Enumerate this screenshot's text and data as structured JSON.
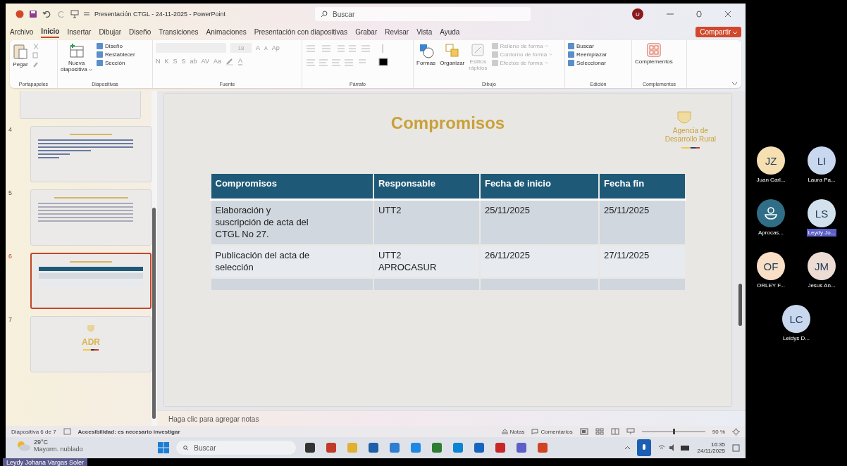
{
  "window": {
    "title": "Presentación CTGL - 24-11-2025 - PowerPoint",
    "search_placeholder": "Buscar",
    "avatar": "U"
  },
  "menu": {
    "tabs": [
      {
        "label": "Archivo",
        "selected": false
      },
      {
        "label": "Inicio",
        "selected": true
      },
      {
        "label": "Insertar",
        "selected": false
      },
      {
        "label": "Dibujar",
        "selected": false
      },
      {
        "label": "Diseño",
        "selected": false
      },
      {
        "label": "Transiciones",
        "selected": false
      },
      {
        "label": "Animaciones",
        "selected": false
      },
      {
        "label": "Presentación con diapositivas",
        "selected": false
      },
      {
        "label": "Grabar",
        "selected": false
      },
      {
        "label": "Revisar",
        "selected": false
      },
      {
        "label": "Vista",
        "selected": false
      },
      {
        "label": "Ayuda",
        "selected": false
      }
    ],
    "share": "Compartir"
  },
  "ribbon": {
    "clipboard": {
      "paste": "Pegar",
      "label": "Portapapeles"
    },
    "slides": {
      "new_slide": [
        "Nueva",
        "diapositiva"
      ],
      "items": [
        "Diseño",
        "Restablecer",
        "Sección"
      ],
      "label": "Diapositivas"
    },
    "font": {
      "size": "18",
      "grow": "A",
      "shrink": "A",
      "clear": "Ap",
      "buttons": [
        "N",
        "K",
        "S",
        "S",
        "ab",
        "AV",
        "Aa"
      ],
      "highlight": "A",
      "label": "Fuente"
    },
    "paragraph": {
      "label": "Párrafo"
    },
    "drawing": {
      "shapes": "Formas",
      "arrange": "Organizar",
      "quick_styles": [
        "Estilos",
        "rápidos"
      ],
      "items": [
        {
          "label": "Relleno de forma",
          "disabled": true
        },
        {
          "label": "Contorno de forma",
          "disabled": true
        },
        {
          "label": "Efectos de forma",
          "disabled": true
        }
      ],
      "label": "Dibujo"
    },
    "editing": {
      "items": [
        "Buscar",
        "Reemplazar",
        "Seleccionar"
      ],
      "label": "Edición"
    },
    "addins": {
      "button": "Complementos",
      "label": "Complementos"
    }
  },
  "thumbnails": [
    {
      "kind": "partial",
      "selected": false
    },
    {
      "number": "4",
      "kind": "agenda",
      "selected": false
    },
    {
      "number": "5",
      "kind": "list",
      "selected": false
    },
    {
      "number": "6",
      "kind": "table",
      "selected": true
    },
    {
      "number": "7",
      "kind": "logo",
      "text": "ADR",
      "selected": false
    }
  ],
  "slide": {
    "title": "Compromisos",
    "logo_lines": [
      "Agencia de",
      "Desarrollo Rural"
    ],
    "table": {
      "columns": [
        "Compromisos",
        "Responsable",
        "Fecha de inicio",
        "Fecha fin"
      ],
      "rows": [
        {
          "cells": [
            [
              "Elaboración y",
              "suscripción de acta del",
              "CTGL No 27."
            ],
            [
              "UTT2"
            ],
            [
              "25/11/2025"
            ],
            [
              "25/11/2025"
            ]
          ]
        },
        {
          "cells": [
            [
              "Publicación del acta de",
              "selección"
            ],
            [
              "UTT2",
              "APROCASUR"
            ],
            [
              "26/11/2025"
            ],
            [
              "27/11/2025"
            ]
          ]
        }
      ]
    }
  },
  "notes_placeholder": "Haga clic para agregar notas",
  "status_bar": {
    "slide_info": "Diapositiva 6 de 7",
    "accessibility": "Accesibilidad: es necesario investigar",
    "notes": "Notas",
    "comments": "Comentarios",
    "zoom": "90 %",
    "zoom_slider": {
      "level": 0.5
    }
  },
  "taskbar": {
    "temperature": "29°C",
    "weather": "Mayorm. nublado",
    "search_placeholder": "Buscar",
    "time": "16:35",
    "date": "24/11/2025"
  },
  "participants": [
    {
      "initials": "JZ",
      "name": "Juan Carl...",
      "color": "#f6dfb0",
      "kind": "initials",
      "highlighted": false
    },
    {
      "initials": "LI",
      "name": "Laura Pa...",
      "color": "#c9d8ee",
      "kind": "initials",
      "highlighted": false
    },
    {
      "name": "Aprocas...",
      "color": "#2f6e86",
      "kind": "guest",
      "highlighted": false
    },
    {
      "initials": "LS",
      "name": "Leydy Jo...",
      "color": "#d2e1ec",
      "kind": "initials",
      "highlighted": true
    },
    {
      "initials": "OF",
      "name": "ORLEY F...",
      "color": "#f8dfc6",
      "kind": "initials",
      "highlighted": false
    },
    {
      "initials": "JM",
      "name": "Jesus An...",
      "color": "#ecdcd4",
      "kind": "initials",
      "highlighted": false
    },
    {
      "initials": "LC",
      "name": "Leidys D...",
      "color": "#c9d8ee",
      "kind": "initials",
      "highlighted": false
    }
  ],
  "presenter_label": "Leydy Johana Vargas Soler"
}
